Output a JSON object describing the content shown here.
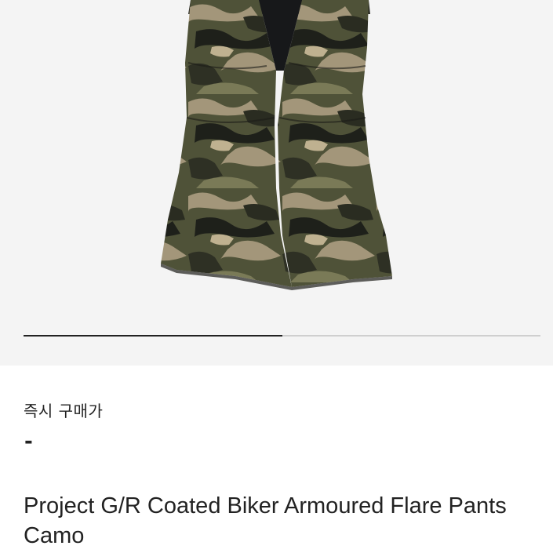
{
  "product": {
    "image_alt": "camouflage flare pants",
    "image_position": 0.5,
    "price_label": "즉시 구매가",
    "price_value": "-",
    "name": "Project G/R Coated Biker Armoured Flare Pants Camo"
  },
  "colors": {
    "background": "#f4f4f4",
    "text": "#222222",
    "pager_active": "#222222",
    "pager_track": "#cfcfcf",
    "camo": [
      "#3b3d2c",
      "#5d5f44",
      "#a3967a",
      "#1e201a",
      "#7a7a57"
    ]
  }
}
